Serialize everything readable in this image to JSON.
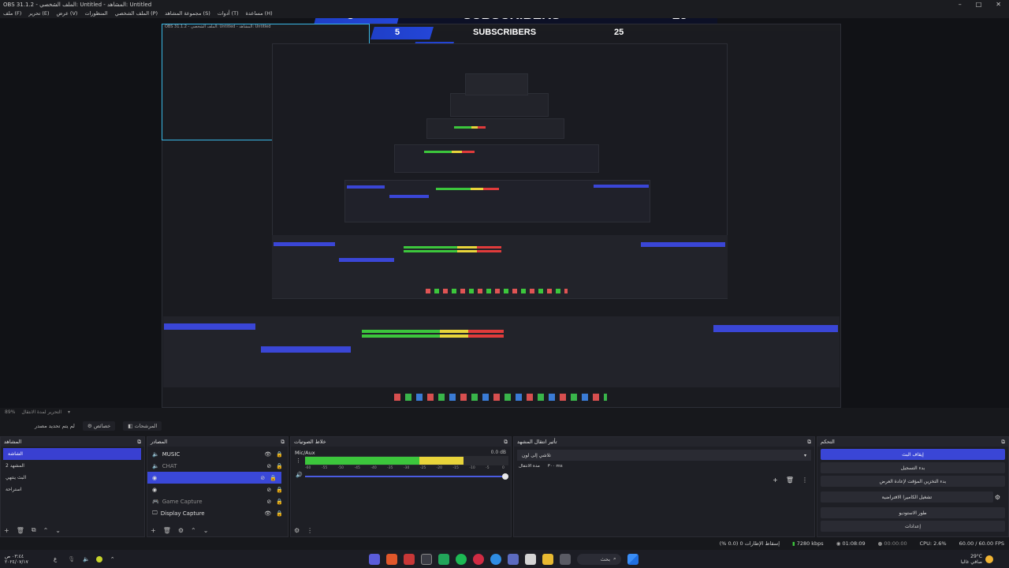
{
  "window": {
    "title": "OBS 31.1.2 - الملف الشخصي: Untitled - المشاهد: Untitled",
    "controls": [
      "–",
      "□",
      "✕"
    ]
  },
  "menu": {
    "items": [
      "ملف (F)",
      "تحرير (E)",
      "عرض (V)",
      "المنظورات",
      "الملف الشخصي (P)",
      "مجموعة المشاهد (S)",
      "أدوات (T)",
      "مساعدة (H)"
    ]
  },
  "overlay": {
    "left_count": "5",
    "label": "SUBSCRIBERS",
    "right_count": "25",
    "colors": {
      "banner": "#2446d8",
      "bar_dark": "#0c1026",
      "selection": "#3940d1",
      "cyan_outline": "#3ab8e6"
    }
  },
  "status_line": {
    "zoom": "89%",
    "hint": "التحرير لمدة الانتقال"
  },
  "mode_tabs": {
    "tab1": "لم يتم تحديد مصدر",
    "tab2": "خصائص",
    "tab3": "المرشحات"
  },
  "scenes": {
    "title": "المشاهد",
    "items": [
      "الشاشة",
      "المشهد 2",
      "البث ينتهي",
      "استراحة"
    ]
  },
  "sources": {
    "title": "المصادر",
    "items": [
      {
        "name": "MUSIC",
        "icon": "speaker-icon"
      },
      {
        "name": "CHAT",
        "icon": "speaker-icon"
      },
      {
        "name": "",
        "icon": "camera-icon"
      },
      {
        "name": "",
        "icon": "camera-icon"
      },
      {
        "name": "Game Capture",
        "icon": "gamepad-icon"
      },
      {
        "name": "Display Capture",
        "icon": "monitor-icon"
      }
    ]
  },
  "audio": {
    "title": "خلاط الصوتيات",
    "channel": "Mic/Aux",
    "db": "0.0 dB",
    "ticks": [
      "-60",
      "-55",
      "-50",
      "-45",
      "-40",
      "-35",
      "-30",
      "-25",
      "-20",
      "-15",
      "-10",
      "-5",
      "0"
    ],
    "level_fraction": 0.78
  },
  "transitions": {
    "title": "تأثير انتقال المشهد",
    "selected": "تلاشي إلى لون",
    "duration_label": "مدة الانتقال",
    "duration_value": "٣٠٠ ms"
  },
  "controls": {
    "title": "التحكم",
    "buttons": [
      "إيقاف البث",
      "بدء التسجيل",
      "بدء التخزين المؤقت لإعادة العرض",
      "تشغيل الكاميرا الافتراضية",
      "طور الاستوديو",
      "إعدادات"
    ]
  },
  "statusbar": {
    "dropped": "إسقاط الإطارات 0 (0.0 %)",
    "kbps": "7280 kbps",
    "stream_time": "01:08:09",
    "rec_time": "00:00:00",
    "cpu": "CPU: 2.6%",
    "fps": "60.00 / 60.00 FPS"
  },
  "taskbar": {
    "search_placeholder": "بحث",
    "weather": "29°C",
    "weather_desc": "صافي غالبا",
    "time": "٠٣:٤٤ ص",
    "date": "٢٠٢٤/٠٧/١٧",
    "lang": "ع"
  }
}
